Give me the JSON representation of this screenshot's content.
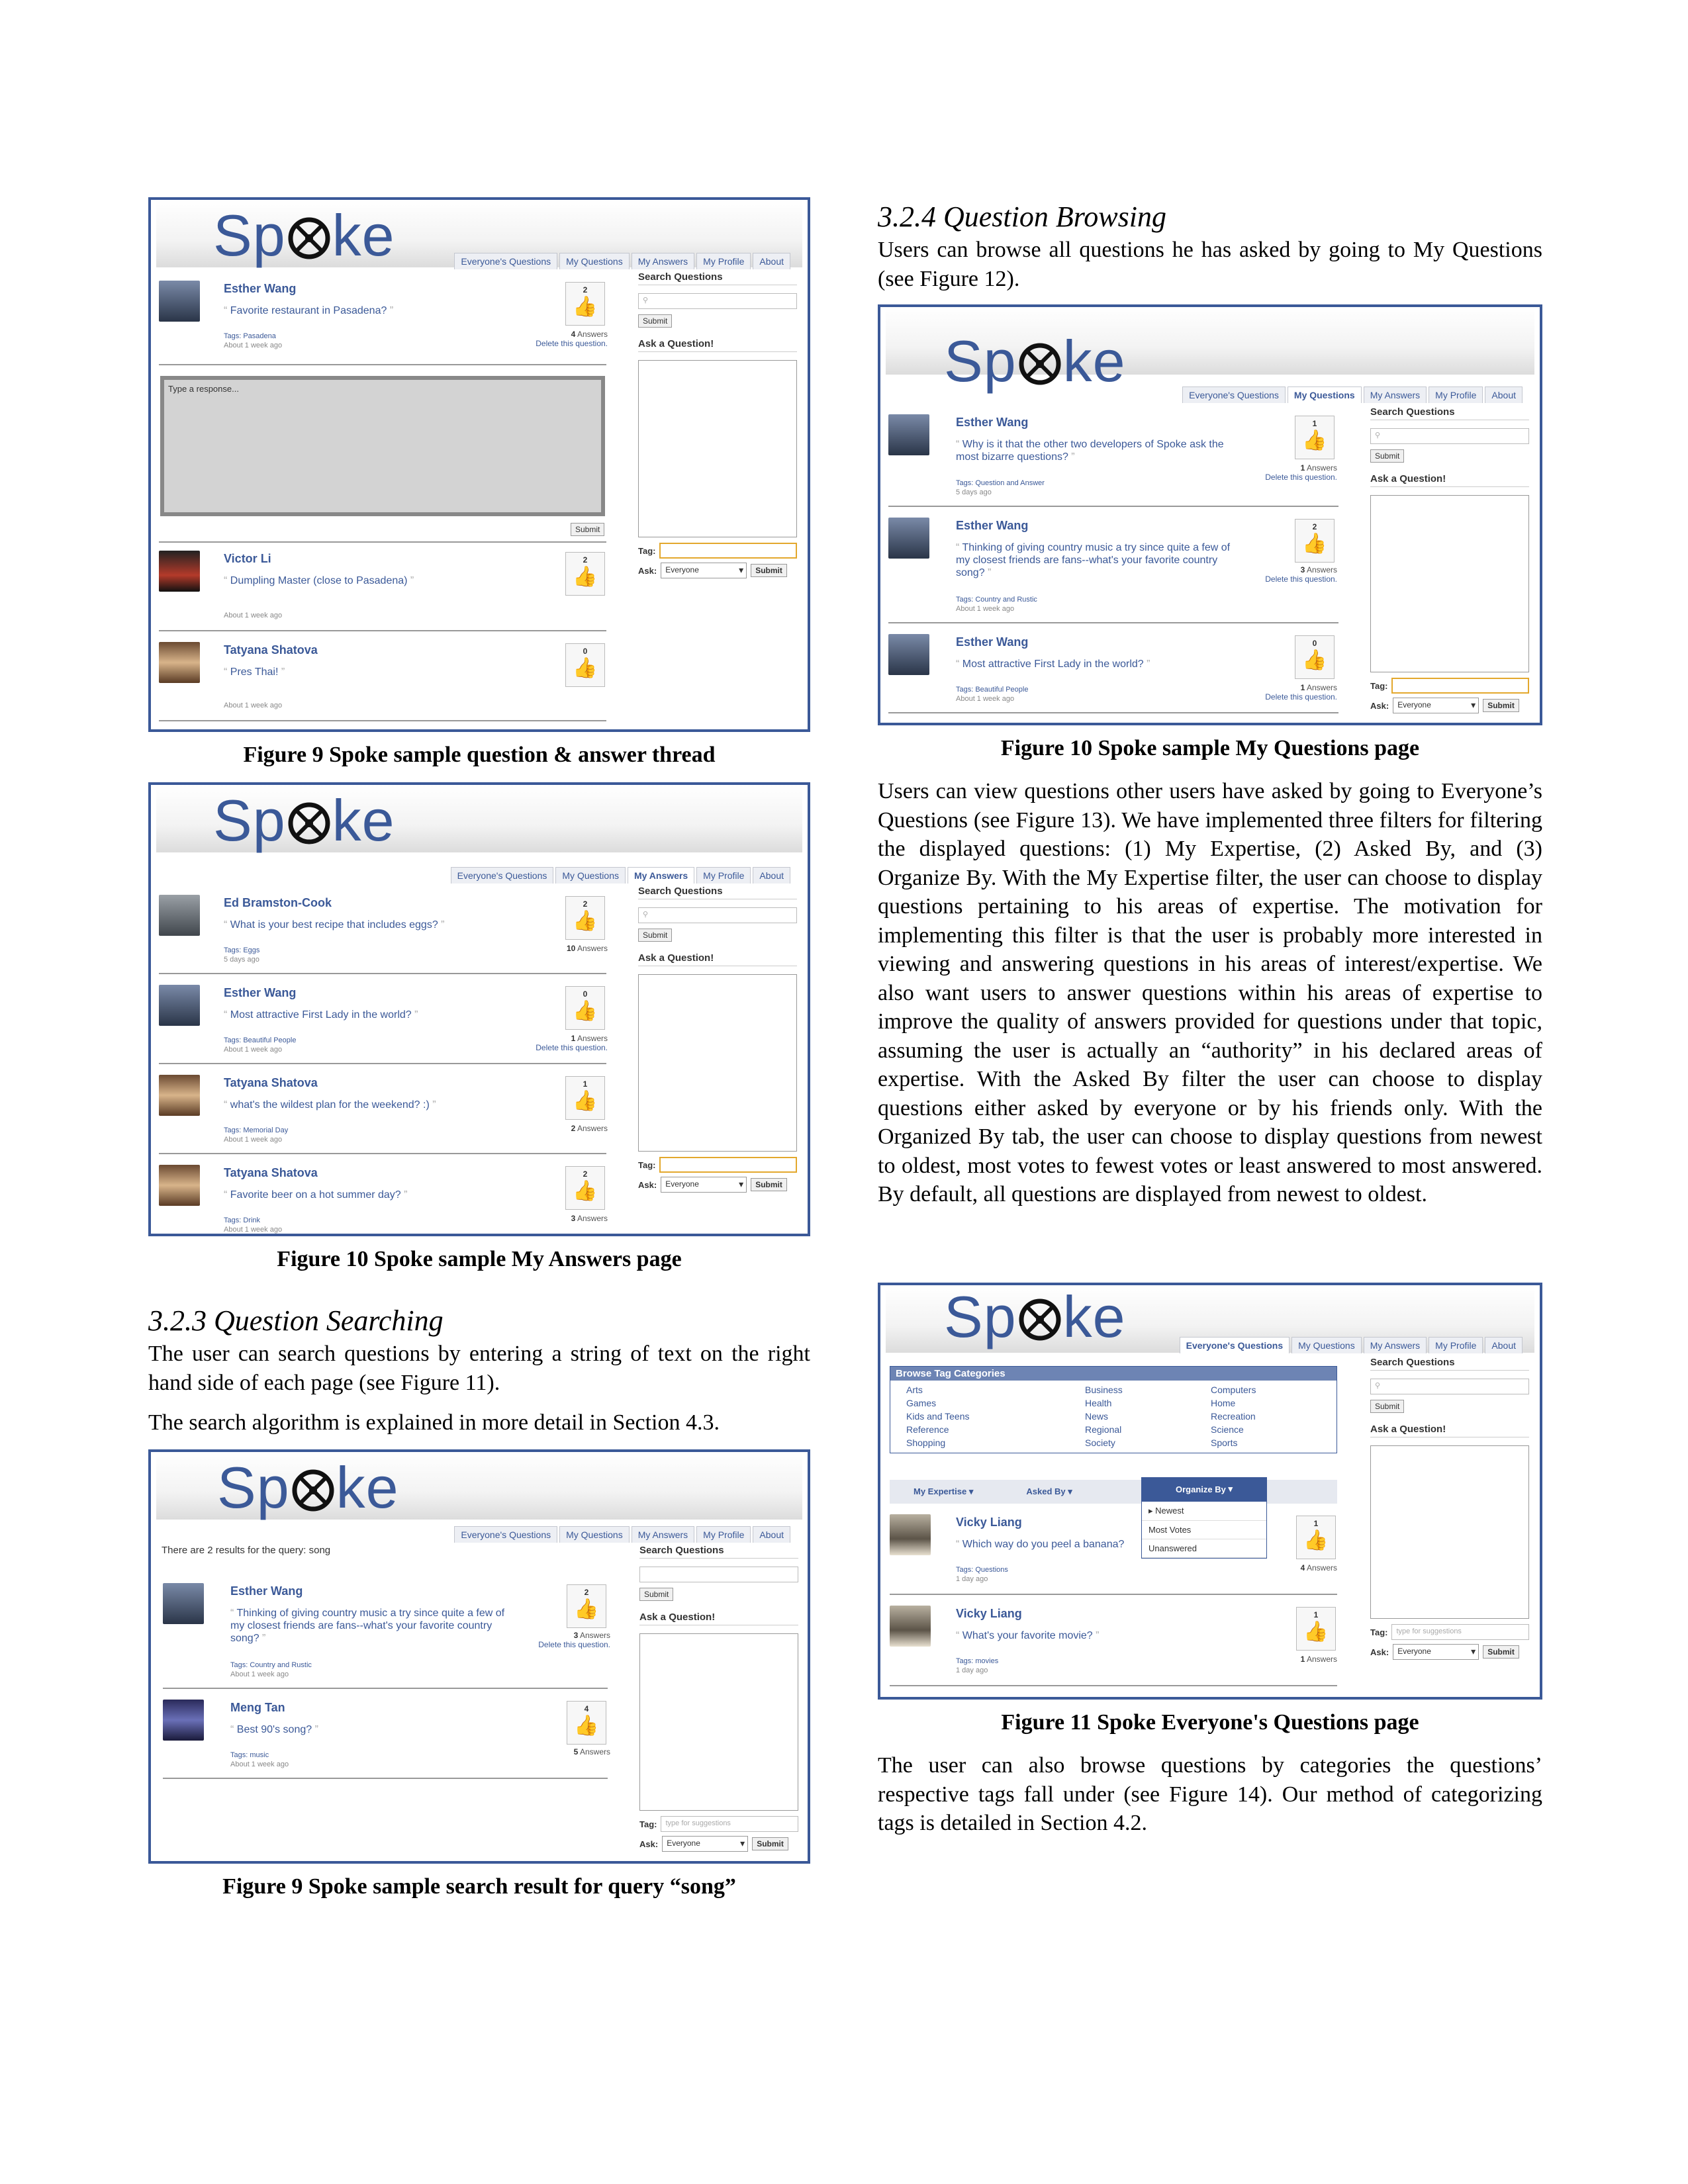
{
  "app": {
    "logo": "Spoke"
  },
  "tabs_labels": [
    "Everyone's Questions",
    "My Questions",
    "My Answers",
    "My Profile",
    "About"
  ],
  "sidebar": {
    "search_label": "Search Questions",
    "submit": "Submit",
    "ask_label": "Ask a Question!",
    "tag_label": "Tag:",
    "ask_sel_label": "Ask:",
    "ask_sel_value": "Everyone",
    "tag_placeholder": "type for suggestions"
  },
  "fig1": {
    "caption": "Figure 9 Spoke sample question & answer thread",
    "post": {
      "user": "Esther Wang",
      "question": "Favorite restaurant in Pasadena?",
      "tags": "Tags: Pasadena",
      "age": "About 1 week ago",
      "votes": "2",
      "answers_count": "4",
      "answers_label": "Answers",
      "delete": "Delete this question."
    },
    "response_placeholder": "Type a response...",
    "submit": "Submit",
    "answers": [
      {
        "user": "Victor Li",
        "text": "Dumpling Master (close to Pasadena)",
        "age": "About 1 week ago",
        "votes": "2"
      },
      {
        "user": "Tatyana Shatova",
        "text": "Pres Thai!",
        "age": "About 1 week ago",
        "votes": "0"
      }
    ]
  },
  "fig2": {
    "caption": "Figure 10 Spoke sample My Answers page",
    "posts": [
      {
        "user": "Ed Bramston-Cook",
        "question": "What is your best recipe that includes eggs?",
        "tags": "Tags: Eggs",
        "age": "5 days ago",
        "votes": "2",
        "answers_count": "10",
        "delete": ""
      },
      {
        "user": "Esther Wang",
        "question": "Most attractive First Lady in the world?",
        "tags": "Tags: Beautiful People",
        "age": "About 1 week ago",
        "votes": "0",
        "answers_count": "1",
        "delete": "Delete this question."
      },
      {
        "user": "Tatyana Shatova",
        "question": "what's the wildest plan for the weekend? :)",
        "tags": "Tags: Memorial Day",
        "age": "About 1 week ago",
        "votes": "1",
        "answers_count": "2",
        "delete": ""
      },
      {
        "user": "Tatyana Shatova",
        "question": "Favorite beer on a hot summer day?",
        "tags": "Tags: Drink",
        "age": "About 1 week ago",
        "votes": "2",
        "answers_count": "3",
        "delete": ""
      }
    ]
  },
  "sec323": {
    "heading": "3.2.3   Question Searching",
    "p1": "The user can search questions by entering a string of text on the right hand side of each page (see Figure 11).",
    "p2": "The search algorithm is explained in more detail in Section 4.3."
  },
  "fig3": {
    "caption": "Figure 9 Spoke sample search result for query “song”",
    "results_text": "There are 2 results for the query: song",
    "posts": [
      {
        "user": "Esther Wang",
        "question": "Thinking of giving country music a try since quite a few of my closest friends are fans--what's your favorite country song?",
        "tags": "Tags: Country and Rustic",
        "age": "About 1 week ago",
        "votes": "2",
        "answers_count": "3",
        "delete": "Delete this question."
      },
      {
        "user": "Meng Tan",
        "question": "Best 90's song?",
        "tags": "Tags: music",
        "age": "About 1 week ago",
        "votes": "4",
        "answers_count": "5",
        "delete": ""
      }
    ]
  },
  "sec324": {
    "heading": "3.2.4   Question Browsing",
    "p1": "Users can browse all questions he has asked by going to My Questions (see Figure 12).",
    "p2": "Users can view questions other users have asked by going to Everyone’s Questions (see Figure 13). We have implemented three filters for filtering the displayed questions: (1) My Expertise, (2) Asked By, and (3) Organize By. With the My Expertise filter, the user can choose to display questions pertaining to his areas of expertise. The motivation for implementing this filter is that the user is probably more interested in viewing and answering questions in his areas of interest/expertise. We also want users to answer questions within his areas of expertise to improve the quality of answers provided for questions under that topic, assuming the user is actually an “authority” in his declared areas of expertise. With the Asked By filter the user can choose to display questions either asked by everyone or by his friends only. With the Organized By tab, the user can choose to display questions from newest to oldest, most votes to fewest votes or least answered to most answered. By default, all questions are displayed from newest to oldest.",
    "p3": "The user can also browse questions by categories the questions’ respective tags fall under (see Figure 14). Our method of categorizing tags is detailed in Section 4.2."
  },
  "fig4": {
    "caption": "Figure 10 Spoke sample My Questions page",
    "posts": [
      {
        "user": "Esther Wang",
        "question": "Why is it that the other two developers of Spoke ask the most bizarre questions?",
        "tags": "Tags: Question and Answer",
        "age": "5 days ago",
        "votes": "1",
        "answers_count": "1",
        "delete": "Delete this question."
      },
      {
        "user": "Esther Wang",
        "question": "Thinking of giving country music a try since quite a few of my closest friends are fans--what's your favorite country song?",
        "tags": "Tags: Country and Rustic",
        "age": "About 1 week ago",
        "votes": "2",
        "answers_count": "3",
        "delete": "Delete this question."
      },
      {
        "user": "Esther Wang",
        "question": "Most attractive First Lady in the world?",
        "tags": "Tags: Beautiful People",
        "age": "About 1 week ago",
        "votes": "0",
        "answers_count": "1",
        "delete": "Delete this question."
      }
    ]
  },
  "fig5": {
    "caption": "Figure 11 Spoke Everyone's Questions page",
    "browse_header": "Browse Tag Categories",
    "categories": [
      "Arts",
      "Business",
      "Computers",
      "Games",
      "Health",
      "Home",
      "Kids and Teens",
      "News",
      "Recreation",
      "Reference",
      "Regional",
      "Science",
      "Shopping",
      "Society",
      "Sports"
    ],
    "filters": {
      "expertise": "My Expertise",
      "asked_by": "Asked By",
      "organize_by": "Organize By"
    },
    "organize_options": [
      "Newest",
      "Most Votes",
      "Unanswered"
    ],
    "posts": [
      {
        "user": "Vicky Liang",
        "question": "Which way do you peel a banana?",
        "tags": "Tags: Questions",
        "age": "1 day ago",
        "votes": "1",
        "answers_count": "4",
        "delete": ""
      },
      {
        "user": "Vicky Liang",
        "question": "What's your favorite movie?",
        "tags": "Tags: movies",
        "age": "1 day ago",
        "votes": "1",
        "answers_count": "1",
        "delete": ""
      }
    ]
  },
  "colors": {
    "brand": "#3b5998",
    "border": "#3b5998"
  }
}
